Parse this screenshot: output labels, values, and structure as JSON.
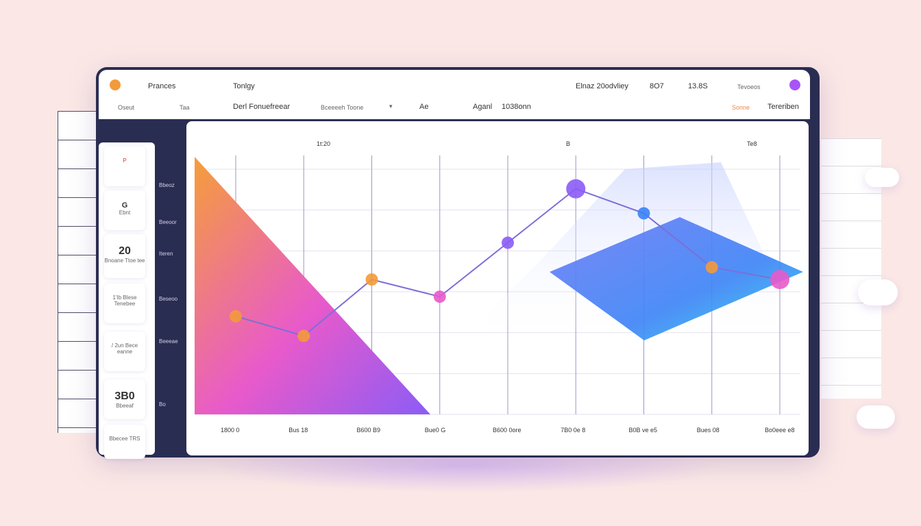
{
  "topbar": {
    "row1": [
      "Prances",
      "Tonlgy",
      "Elnaz 20odvliey",
      "8O7",
      "13.8S",
      "Tevoeos"
    ],
    "row2": [
      "Oseut",
      "Taa",
      "Derl Fonuefreear",
      "Bceeeeh  Toone",
      "Ae",
      "Aganl",
      "1038onn",
      "Sonne",
      "Tereriben"
    ]
  },
  "sidebar": {
    "cards": [
      {
        "big": "",
        "sub": "P"
      },
      {
        "big": "G",
        "sub": "Ebnt"
      },
      {
        "big": "20",
        "sub": "Bnoane Ttoe tee"
      },
      {
        "big": "",
        "sub": "1'Ib Blese Tenebee"
      },
      {
        "big": "",
        "sub": "/ 2un Bece eanne"
      },
      {
        "big": "3B0",
        "sub": "Bbeeaf"
      },
      {
        "big": "",
        "sub": "Bbecee TRS"
      }
    ],
    "nav": [
      "Bbeoz",
      "Beeoor",
      "Iteren",
      "Beseoo",
      "Beeeae",
      "Bo"
    ]
  },
  "chart_data": {
    "type": "line",
    "top_labels": [
      "1t:20",
      "B",
      "Te8"
    ],
    "x": [
      "1800 0",
      "Bus 18",
      "B600 B9",
      "Bue0 G",
      "B600 0ore",
      "7B0 0e 8",
      "B0B ve e5",
      "Bues 08",
      "Bo0eee e8"
    ],
    "series": [
      {
        "values": [
          40,
          32,
          55,
          48,
          70,
          92,
          82,
          60,
          55
        ]
      }
    ]
  },
  "colors": {
    "accent_orange": "#f39a3a",
    "accent_pink": "#e85acb",
    "accent_purple": "#8b5cf6",
    "accent_blue": "#3b82f6",
    "accent_cyan": "#22d3ee",
    "frame": "#2a2d52"
  }
}
